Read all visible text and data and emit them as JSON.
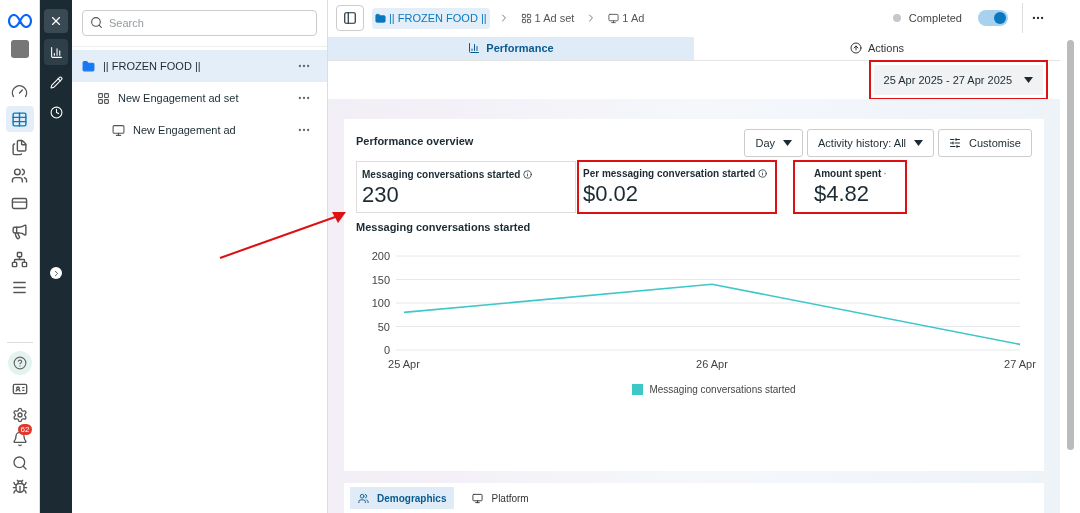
{
  "nav_rail": {
    "items": [
      {
        "selected": false
      },
      {
        "selected": true
      },
      {
        "selected": false
      },
      {
        "selected": false
      },
      {
        "selected": false
      },
      {
        "selected": false
      },
      {
        "selected": false
      },
      {
        "selected": false
      }
    ],
    "notification_badge": "62"
  },
  "tool_rail": {
    "items": [
      {
        "selected": true
      },
      {
        "selected": false
      },
      {
        "selected": false
      }
    ]
  },
  "tree": {
    "search": {
      "placeholder": "Search"
    },
    "items": [
      {
        "label": "|| FROZEN FOOD ||",
        "selected": true,
        "children": [
          {
            "label": "New Engagement ad set",
            "selected": false,
            "children": [
              {
                "label": "New Engagement ad",
                "selected": false
              }
            ]
          }
        ]
      }
    ]
  },
  "header": {
    "breadcrumbs": [
      {
        "label": "|| FROZEN FOOD ||",
        "kind": "campaign"
      },
      {
        "label": "1 Ad set",
        "kind": "adset"
      },
      {
        "label": "1 Ad",
        "kind": "ad"
      }
    ],
    "status": "Completed",
    "toggle_on": true
  },
  "tabs": [
    {
      "label": "Performance",
      "selected": true
    },
    {
      "label": "Actions",
      "selected": false
    }
  ],
  "date_range": {
    "label": "25 Apr 2025 - 27 Apr 2025",
    "highlighted": true
  },
  "overview": {
    "title": "Performance overview",
    "controls": [
      {
        "label": "Day",
        "kind": "dropdown"
      },
      {
        "label": "Activity history: All",
        "kind": "dropdown"
      },
      {
        "label": "Customise",
        "kind": "customise"
      }
    ],
    "metrics": [
      {
        "label": "Messaging conversations started",
        "value": "230",
        "selected": true,
        "highlighted": false
      },
      {
        "label": "Per messaging conversation started",
        "value": "$0.02",
        "selected": false,
        "highlighted": true
      },
      {
        "label": "Amount spent",
        "value": "$4.82",
        "selected": false,
        "highlighted": true
      }
    ],
    "chart_title": "Messaging conversations started",
    "chart_data": {
      "type": "line",
      "grid": true,
      "categories": [
        "25 Apr",
        "26 Apr",
        "27 Apr"
      ],
      "ylim": [
        0,
        200
      ],
      "yticks": [
        0,
        50,
        100,
        150,
        200
      ],
      "series": [
        {
          "name": "Messaging conversations started",
          "color": "#3cc8c8",
          "values": [
            80,
            140,
            12
          ]
        }
      ]
    }
  },
  "bottom_tabs": [
    {
      "label": "Demographics",
      "selected": true
    },
    {
      "label": "Platform",
      "selected": false
    }
  ]
}
